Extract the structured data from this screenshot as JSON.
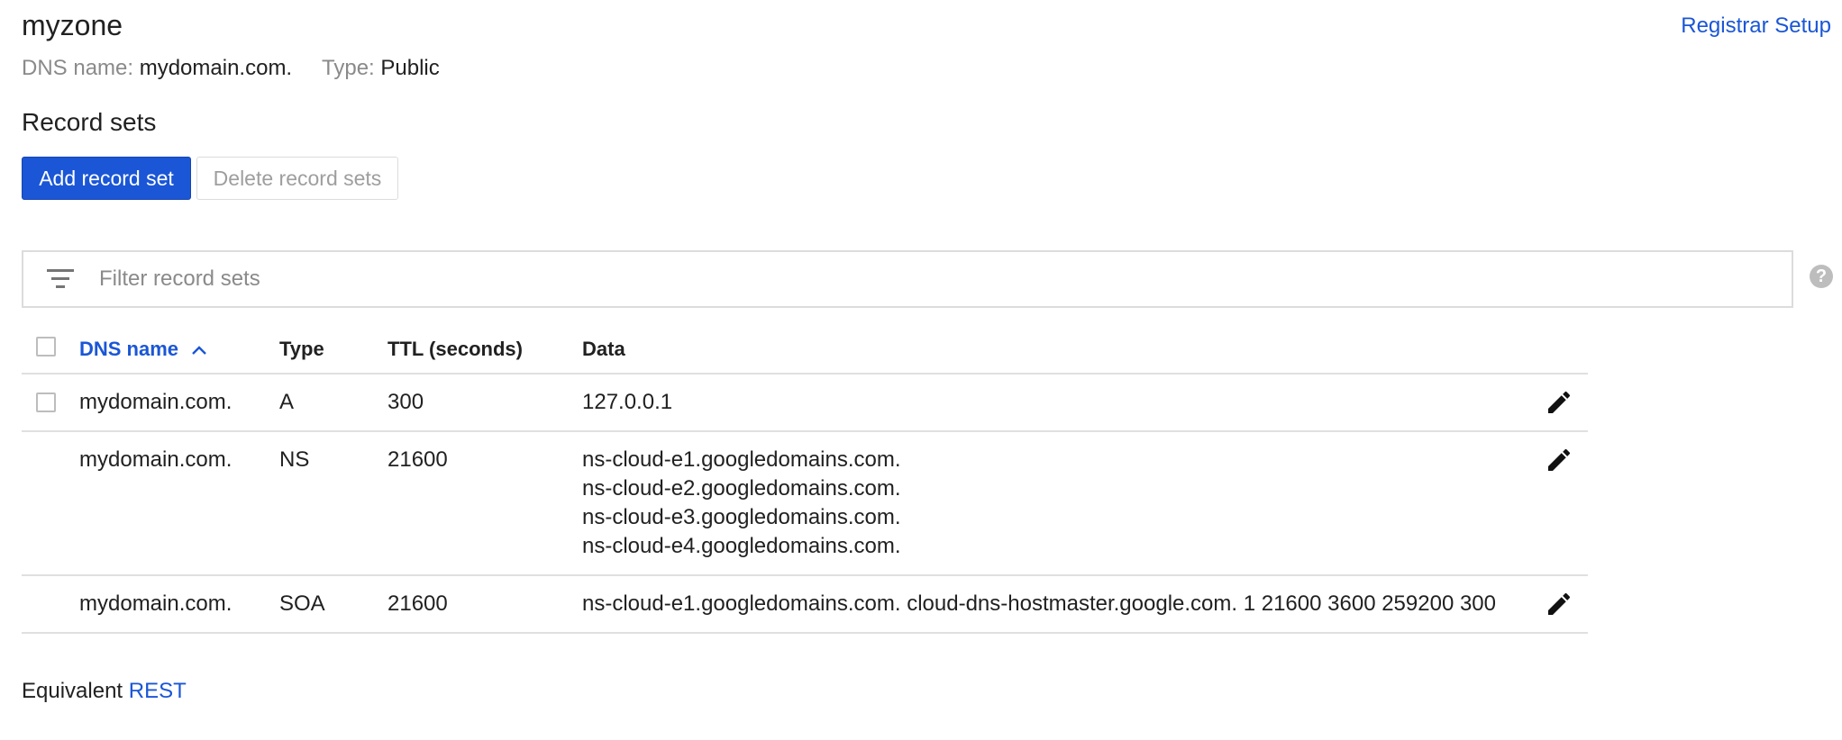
{
  "zone": {
    "title": "myzone",
    "dns_name_label": "DNS name:",
    "dns_name_value": "mydomain.com.",
    "type_label": "Type:",
    "type_value": "Public"
  },
  "header": {
    "registrar_link": "Registrar Setup"
  },
  "record_sets": {
    "title": "Record sets",
    "add_button": "Add record set",
    "delete_button": "Delete record sets"
  },
  "filter": {
    "placeholder": "Filter record sets",
    "icon": "filter-icon",
    "help_icon": "help-icon"
  },
  "table": {
    "columns": [
      "DNS name",
      "Type",
      "TTL (seconds)",
      "Data"
    ],
    "sort_column": "DNS name",
    "sort_direction": "ascending",
    "rows": [
      {
        "dns_name": "mydomain.com.",
        "type": "A",
        "ttl": "300",
        "data": [
          "127.0.0.1"
        ],
        "selectable": true
      },
      {
        "dns_name": "mydomain.com.",
        "type": "NS",
        "ttl": "21600",
        "data": [
          "ns-cloud-e1.googledomains.com.",
          "ns-cloud-e2.googledomains.com.",
          "ns-cloud-e3.googledomains.com.",
          "ns-cloud-e4.googledomains.com."
        ],
        "selectable": false
      },
      {
        "dns_name": "mydomain.com.",
        "type": "SOA",
        "ttl": "21600",
        "data": [
          "ns-cloud-e1.googledomains.com. cloud-dns-hostmaster.google.com. 1 21600 3600 259200 300"
        ],
        "selectable": false
      }
    ]
  },
  "footer": {
    "equivalent_label": "Equivalent",
    "rest_link": "REST"
  },
  "colors": {
    "accent": "#1a56d6",
    "muted_text": "#8a8a8a",
    "border": "#dcdcdc"
  }
}
